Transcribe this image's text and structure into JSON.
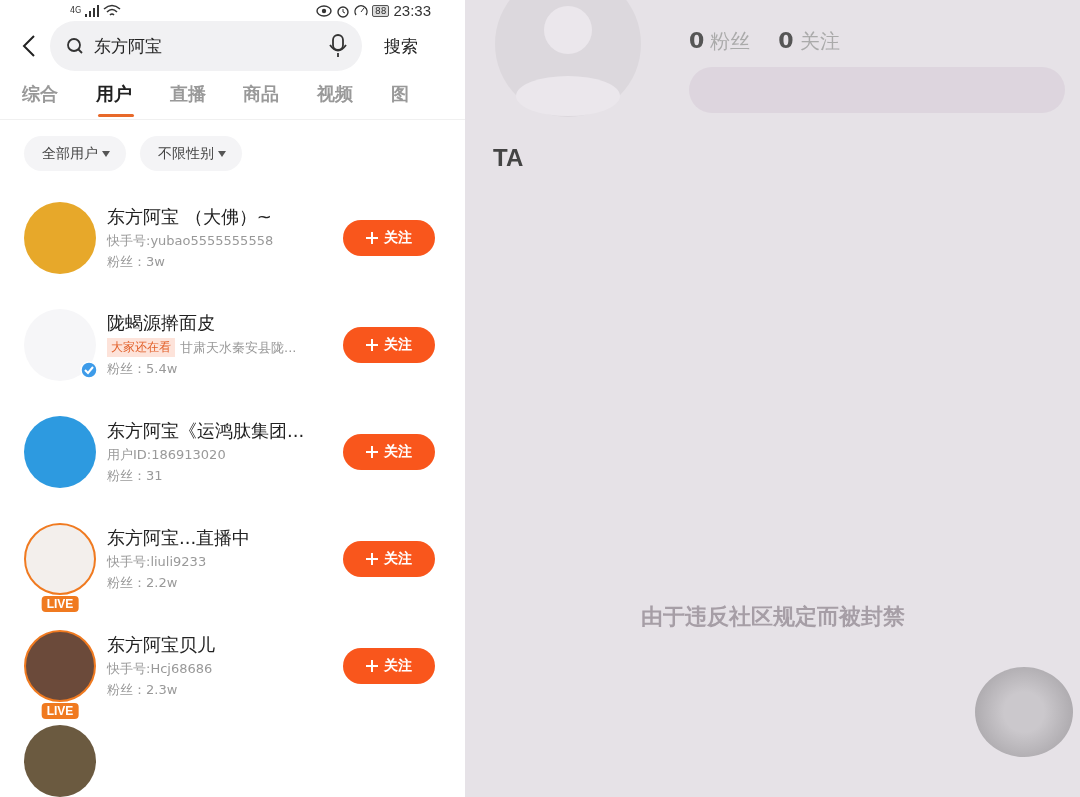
{
  "status_bar": {
    "network": "4G",
    "battery": "88",
    "time": "23:33"
  },
  "search": {
    "value": "东方阿宝",
    "button": "搜索"
  },
  "tabs": [
    {
      "label": "综合",
      "selected": false
    },
    {
      "label": "用户",
      "selected": true
    },
    {
      "label": "直播",
      "selected": false
    },
    {
      "label": "商品",
      "selected": false
    },
    {
      "label": "视频",
      "selected": false
    },
    {
      "label": "图",
      "selected": false
    }
  ],
  "filters": [
    "全部用户",
    "不限性别"
  ],
  "users": [
    {
      "name": "东方阿宝 （大佛）~",
      "detail": "快手号:yubao5555555558",
      "fans": "粉丝：3w",
      "verified": false,
      "follow": "关注"
    },
    {
      "name": "陇蝎源擀面皮",
      "tag": "大家还在看",
      "detail": "甘肃天水秦安县陇...",
      "fans": "粉丝：5.4w",
      "verified": true,
      "follow": "关注"
    },
    {
      "name": "东方阿宝《运鸿肽集团...",
      "detail": "用户ID:186913020",
      "fans": "粉丝：31",
      "verified": false,
      "follow": "关注"
    },
    {
      "name": "东方阿宝...直播中",
      "detail": "快手号:liuli9233",
      "fans": "粉丝：2.2w",
      "live": "LIVE",
      "verified": false,
      "follow": "关注"
    },
    {
      "name": "东方阿宝贝儿",
      "detail": "快手号:Hcj68686",
      "fans": "粉丝：2.3w",
      "live": "LIVE",
      "verified": false,
      "follow": "关注"
    }
  ],
  "profile": {
    "stats": [
      {
        "count": "0",
        "label": "粉丝"
      },
      {
        "count": "0",
        "label": "关注"
      }
    ],
    "heading": "TA",
    "notice": "由于违反社区规定而被封禁"
  }
}
